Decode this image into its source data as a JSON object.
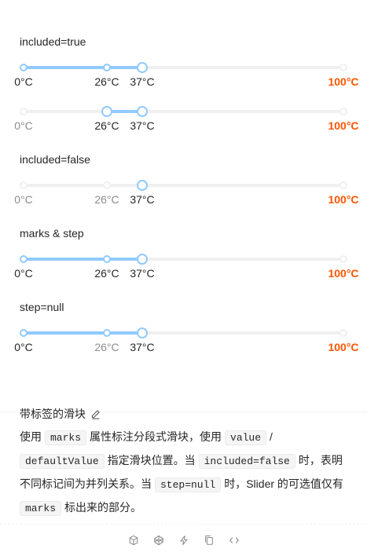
{
  "sections": [
    {
      "title": "included=true"
    },
    {
      "title": "included=false"
    },
    {
      "title": "marks & step"
    },
    {
      "title": "step=null"
    }
  ],
  "marks": {
    "m0": "0°C",
    "m26": "26°C",
    "m37": "37°C",
    "m100": "100°C"
  },
  "sliders": {
    "included_single": {
      "value": 37,
      "included": true
    },
    "included_range": {
      "value": [
        26,
        37
      ],
      "included": true
    },
    "excluded_single": {
      "value": 37,
      "included": false
    },
    "marks_step": {
      "value": 37,
      "included": true
    },
    "step_null": {
      "value": 37,
      "included": true
    }
  },
  "meta": {
    "title": "带标签的滑块",
    "desc": {
      "t1": "使用",
      "c1": "marks",
      "t2": "属性标注分段式滑块，使用",
      "c2": "value",
      "t3": "/",
      "c3": "defaultValue",
      "t4": "指定滑块位置。当",
      "c4": "included=false",
      "t5": "时，表明不同标记间为并列关系。当",
      "c5": "step=null",
      "t6": "时，Slider 的可选值仅有",
      "c6": "marks",
      "t7": "标出来的部分。"
    }
  },
  "colors": {
    "accent": "#91caff",
    "strong_mark": "#ff5500",
    "rail": "#f0f0f0"
  },
  "action_icons": [
    "codesandbox-icon",
    "codepen-icon",
    "thunderbolt-icon",
    "copy-icon",
    "code-icon"
  ]
}
